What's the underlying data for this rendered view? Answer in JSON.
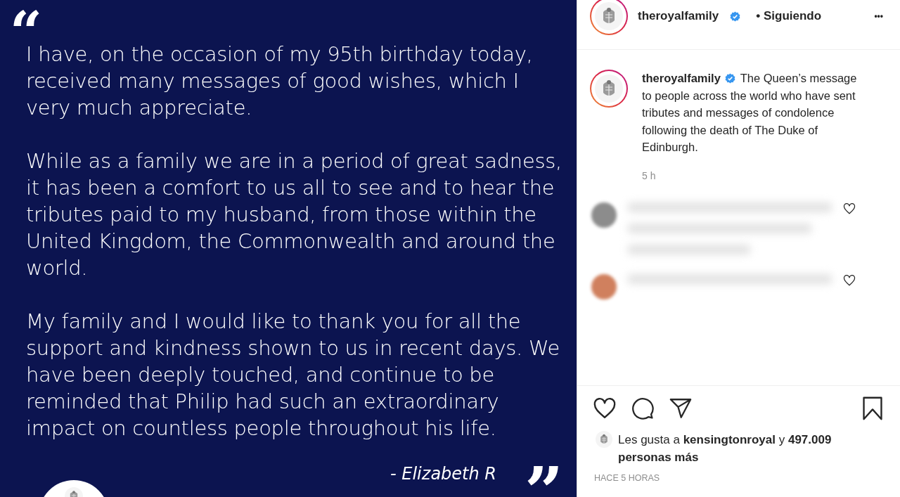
{
  "post_image": {
    "open_quote": "“",
    "paragraphs": [
      "I have, on the occasion of my 95th birthday today, received many messages of good wishes, which I very much appreciate.",
      "While as a family we are in a period of great sadness, it has been a comfort to us all to see and to hear the tributes paid to my husband, from those within the United Kingdom, the Commonwealth and around the world.",
      "My family and I would like to thank you for all the support and kindness shown to us in recent days. We have been deeply touched, and continue to be reminded that Philip had such an extraordinary impact on countless people throughout his life."
    ],
    "signature": "- Elizabeth R",
    "close_quote": "”"
  },
  "header": {
    "username": "theroyalfamily",
    "verified": true,
    "follow_status": "• Siguiendo",
    "more": "•••"
  },
  "caption": {
    "username": "theroyalfamily",
    "verified": true,
    "text": "The Queen’s message to people across the world who have sent tributes and messages of condolence following the death of The Duke of Edinburgh.",
    "time": "5 h"
  },
  "comments": [
    {
      "kind": "blurred",
      "color": "#8c8c8c"
    },
    {
      "kind": "blurred",
      "color": "#d0805e"
    }
  ],
  "likes": {
    "prefix": "Les gusta a",
    "user": "kensingtonroyal",
    "middle": "y",
    "count": "497.009 personas más"
  },
  "timestamp": "HACE 5 HORAS"
}
